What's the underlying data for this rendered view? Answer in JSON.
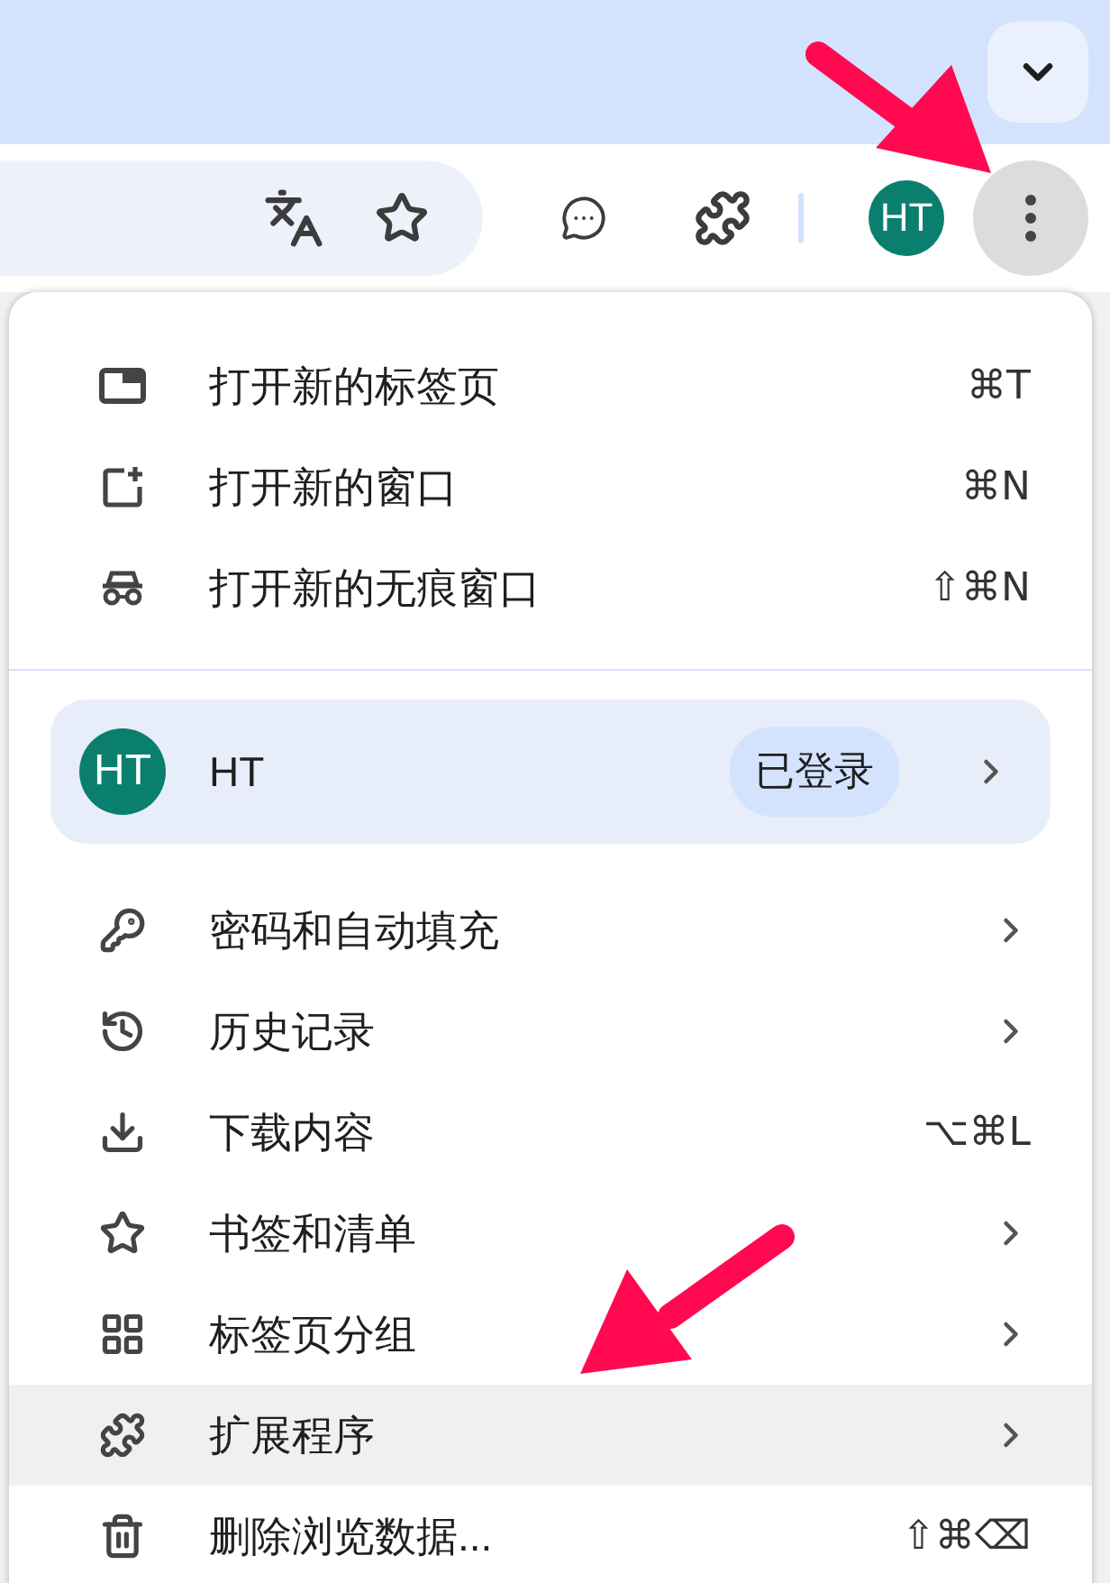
{
  "toolbar": {
    "avatar": "HT"
  },
  "menu": {
    "top_items": [
      {
        "label": "打开新的标签页",
        "shortcut": "⌘T",
        "selected": false
      },
      {
        "label": "打开新的窗口",
        "shortcut": "⌘N",
        "selected": false
      },
      {
        "label": "打开新的无痕窗口",
        "shortcut": "⇧⌘N",
        "selected": false
      }
    ],
    "profile": {
      "avatar": "HT",
      "name": "HT",
      "status": "已登录"
    },
    "items": [
      {
        "label": "密码和自动填充",
        "kind": "submenu",
        "selected": false
      },
      {
        "label": "历史记录",
        "kind": "submenu",
        "selected": false
      },
      {
        "label": "下载内容",
        "kind": "shortcut",
        "shortcut": "⌥⌘L",
        "selected": false
      },
      {
        "label": "书签和清单",
        "kind": "submenu",
        "selected": false
      },
      {
        "label": "标签页分组",
        "kind": "submenu",
        "selected": false
      },
      {
        "label": "扩展程序",
        "kind": "submenu",
        "selected": true
      },
      {
        "label": "删除浏览数据...",
        "kind": "shortcut",
        "shortcut": "⇧⌘⌫",
        "selected": false
      }
    ]
  }
}
